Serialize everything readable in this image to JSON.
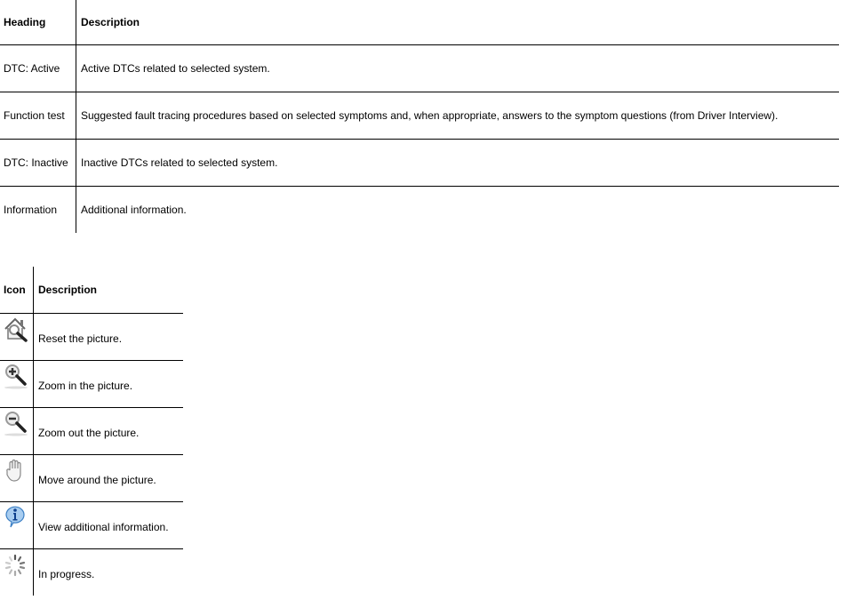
{
  "table1": {
    "headers": [
      "Heading",
      "Description"
    ],
    "rows": [
      {
        "heading": "DTC: Active",
        "description": "Active DTCs related to selected system."
      },
      {
        "heading": "Function test",
        "description": "Suggested fault tracing procedures based on selected symptoms and, when appropriate, answers to the symptom questions (from Driver Interview)."
      },
      {
        "heading": "DTC: Inactive",
        "description": "Inactive DTCs related to selected system."
      },
      {
        "heading": "Information",
        "description": "Additional information."
      }
    ]
  },
  "table2": {
    "headers": [
      "Icon",
      "Description"
    ],
    "rows": [
      {
        "icon": "reset-picture-icon",
        "description": "Reset the picture."
      },
      {
        "icon": "zoom-in-icon",
        "description": "Zoom in the picture."
      },
      {
        "icon": "zoom-out-icon",
        "description": "Zoom out the picture."
      },
      {
        "icon": "pan-hand-icon",
        "description": "Move around the picture."
      },
      {
        "icon": "info-icon",
        "description": "View additional information."
      },
      {
        "icon": "progress-spinner-icon",
        "description": "In progress."
      }
    ]
  }
}
